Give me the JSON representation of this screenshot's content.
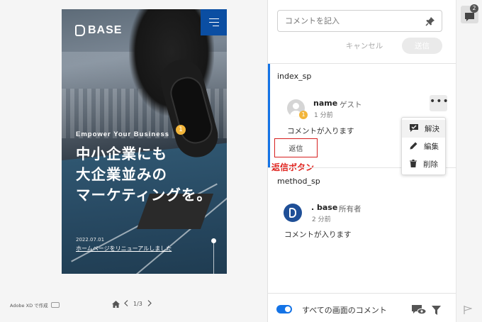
{
  "preview": {
    "brand_name": "BASE",
    "tagline": "Empower Your Business",
    "headline_lines": [
      "中小企業にも",
      "大企業並みの",
      "マーケティングを。"
    ],
    "news_date": "2022.07.01",
    "news_title": "ホームページをリニューアルしました",
    "comment_marker": "1"
  },
  "footer_left": {
    "made_with": "Adobe XD で作成",
    "pager": "1/3"
  },
  "comment_panel": {
    "input_placeholder": "コメントを記入",
    "cancel_label": "キャンセル",
    "send_label": "送信",
    "threads": [
      {
        "title": "index_sp",
        "author": "name",
        "role": "ゲスト",
        "time": "1 分前",
        "text": "コメントが入ります",
        "reply_label": "返信",
        "marker": "1"
      },
      {
        "title": "method_sp",
        "author": ". base",
        "role": "所有者",
        "time": "2 分前",
        "text": "コメントが入ります"
      }
    ],
    "context_menu": [
      "解決",
      "編集",
      "削除"
    ],
    "annotation": "返信ボタン",
    "toggle_label": "すべての画面のコメント",
    "toggle_on": true
  },
  "right_strip": {
    "comment_count": "2"
  },
  "colors": {
    "accent": "#1473e6",
    "brand_blue": "#0b4ea2",
    "marker": "#f2b53a",
    "annotation_red": "#e0241f"
  },
  "icons": [
    "menu-icon",
    "pin-icon",
    "more-icon",
    "check-comment-icon",
    "pencil-icon",
    "trash-icon",
    "home-icon",
    "chevron-left-icon",
    "chevron-right-icon",
    "eye-icon",
    "filter-icon",
    "comments-icon",
    "flag-icon",
    "camera-icon"
  ]
}
